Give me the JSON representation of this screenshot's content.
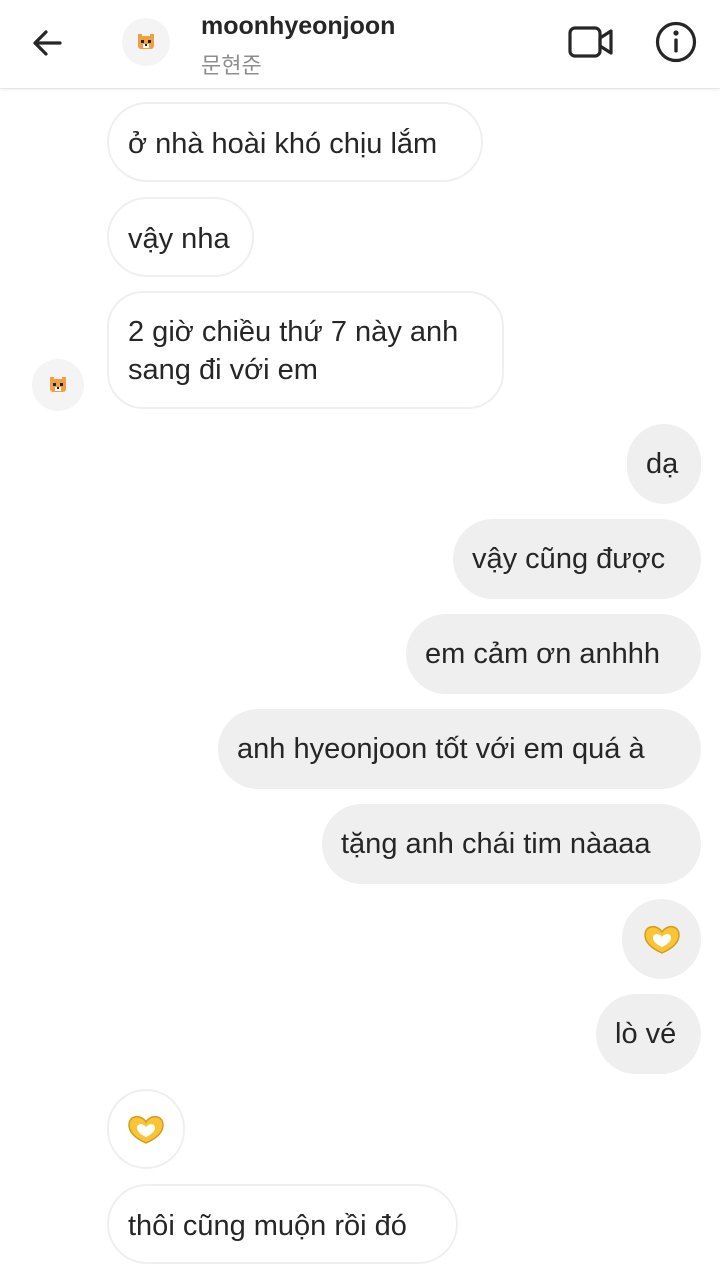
{
  "header": {
    "username": "moonhyeonjoon",
    "subtitle": "문현준",
    "icons": {
      "back": "arrow-left-icon",
      "video": "video-call-icon",
      "info": "info-icon",
      "avatar": "tiger-avatar"
    }
  },
  "messages": [
    {
      "side": "received",
      "text": "ở nhà hoài khó chịu lắm"
    },
    {
      "side": "received",
      "text": "vậy nha"
    },
    {
      "side": "received",
      "text": "2 giờ chiều thứ 7 này anh sang đi với em"
    },
    {
      "side": "sent",
      "text": "dạ"
    },
    {
      "side": "sent",
      "text": "vậy cũng được"
    },
    {
      "side": "sent",
      "text": "em cảm ơn anhhh"
    },
    {
      "side": "sent",
      "text": "anh hyeonjoon tốt với em quá à"
    },
    {
      "side": "sent",
      "text": "tặng anh chái tim nàaaa"
    },
    {
      "side": "sent",
      "emoji": "heart-hands-emoji"
    },
    {
      "side": "sent",
      "text": "lò vé"
    },
    {
      "side": "received",
      "emoji": "heart-hands-emoji"
    },
    {
      "side": "received",
      "text": "thôi cũng muộn rồi đó"
    }
  ],
  "colors": {
    "sent_bubble": "#efefef",
    "received_border": "#efefef",
    "text": "#262626",
    "subtitle": "#8e8e8e",
    "emoji_yellow": "#f8c537"
  }
}
